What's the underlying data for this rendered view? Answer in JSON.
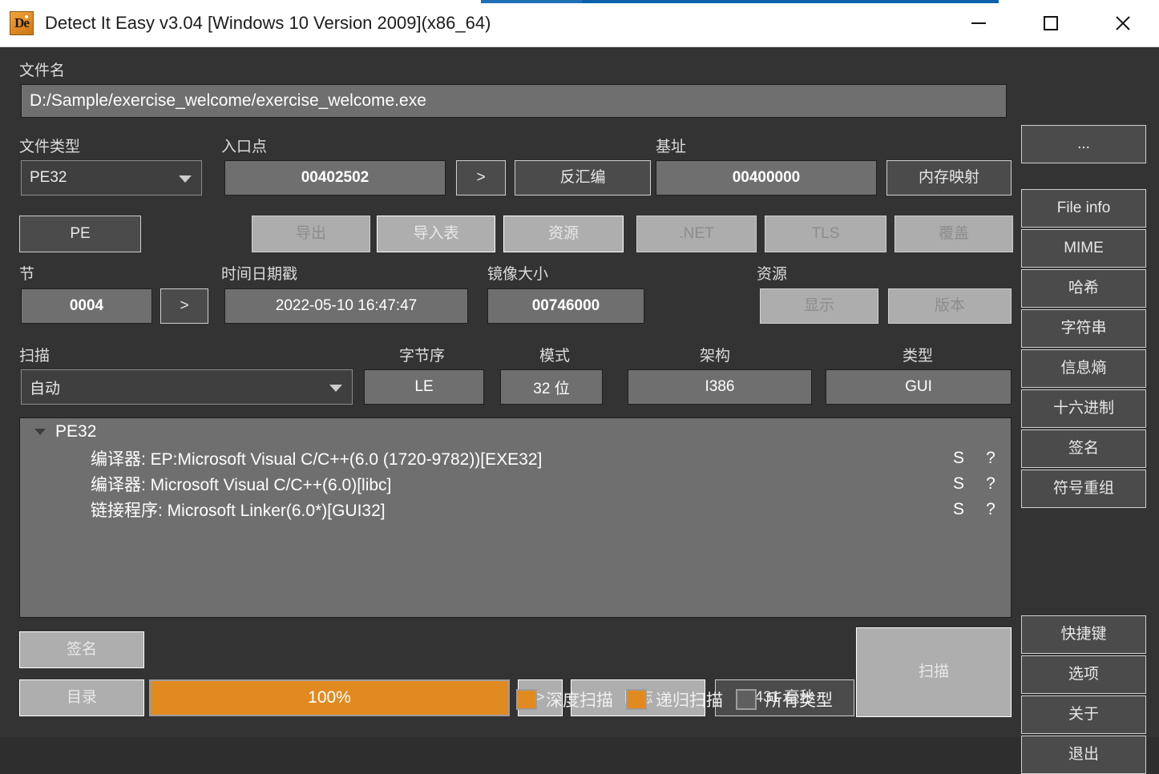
{
  "window": {
    "title": "Detect It Easy v3.04 [Windows 10 Version 2009](x86_64)",
    "icon_text": "De",
    "minimize_label": "minimize",
    "maximize_label": "maximize",
    "close_label": "close"
  },
  "filename": {
    "label": "文件名",
    "value": "D:/Sample/exercise_welcome/exercise_welcome.exe",
    "browse_label": "..."
  },
  "filetype": {
    "label": "文件类型",
    "value": "PE32"
  },
  "entrypoint": {
    "label": "入口点",
    "value": "00402502",
    "next_label": ">",
    "disasm_label": "反汇编"
  },
  "baseaddress": {
    "label": "基址",
    "value": "00400000",
    "memorymap_label": "内存映射"
  },
  "format_tabs": [
    {
      "label": "PE",
      "state": "active"
    },
    {
      "label": "导出",
      "state": "disabled"
    },
    {
      "label": "导入表",
      "state": "enabled"
    },
    {
      "label": "资源",
      "state": "enabled"
    },
    {
      "label": ".NET",
      "state": "disabled"
    },
    {
      "label": "TLS",
      "state": "disabled"
    },
    {
      "label": "覆盖",
      "state": "disabled"
    }
  ],
  "sections": {
    "label": "节",
    "value": "0004",
    "next_label": ">"
  },
  "timestamp": {
    "label": "时间日期戳",
    "value": "2022-05-10 16:47:47"
  },
  "imagesize": {
    "label": "镜像大小",
    "value": "00746000"
  },
  "resources": {
    "label": "资源",
    "show_label": "显示",
    "version_label": "版本"
  },
  "scan": {
    "label": "扫描",
    "value": "自动"
  },
  "endianness": {
    "label": "字节序",
    "value": "LE"
  },
  "mode": {
    "label": "模式",
    "value": "32 位"
  },
  "architecture": {
    "label": "架构",
    "value": "I386"
  },
  "filetype_out": {
    "label": "类型",
    "value": "GUI"
  },
  "results": {
    "root": "PE32",
    "rows": [
      {
        "text": "编译器: EP:Microsoft Visual C/C++(6.0 (1720-9782))[EXE32]",
        "sig": "S",
        "info": "?"
      },
      {
        "text": "编译器: Microsoft Visual C/C++(6.0)[libc]",
        "sig": "S",
        "info": "?"
      },
      {
        "text": "链接程序: Microsoft Linker(6.0*)[GUI32]",
        "sig": "S",
        "info": "?"
      }
    ]
  },
  "bottom": {
    "signatures_label": "签名",
    "directory_label": "目录",
    "progress_text": "100%",
    "progress_percent": 100,
    "log_next_label": ">",
    "log_label": "日志",
    "elapsed_label": "431 毫秒",
    "scan_label": "扫描",
    "checkboxes": [
      {
        "label": "深度扫描",
        "checked": true
      },
      {
        "label": "递归扫描",
        "checked": true
      },
      {
        "label": "所有类型",
        "checked": false
      }
    ]
  },
  "sidebar": {
    "group1": [
      "File info",
      "MIME",
      "哈希",
      "字符串",
      "信息熵",
      "十六进制",
      "签名",
      "符号重组"
    ],
    "group2": [
      "快捷键",
      "选项",
      "关于",
      "退出"
    ]
  },
  "colors": {
    "accent_orange": "#e18a20",
    "panel_bg": "#333333",
    "field_bg": "#6f6f6f",
    "button_bg": "#4b4b4b"
  }
}
